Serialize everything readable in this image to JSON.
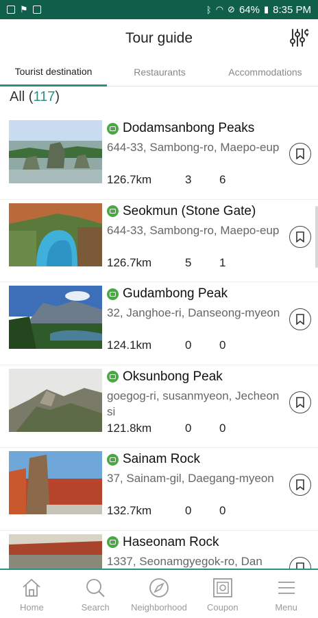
{
  "status_bar": {
    "battery": "64%",
    "time": "8:35 PM",
    "left_icons": [
      "image-icon",
      "flag-icon",
      "google-icon"
    ],
    "right_icons": [
      "bluetooth-icon",
      "wifi-icon",
      "do-not-disturb-icon",
      "battery-icon"
    ]
  },
  "header": {
    "title": "Tour guide",
    "filter_icon": "sliders-icon"
  },
  "tabs": [
    {
      "label": "Tourist destination",
      "active": true
    },
    {
      "label": "Restaurants",
      "active": false
    },
    {
      "label": "Accommodations",
      "active": false
    }
  ],
  "summary": {
    "label": "All",
    "open": "(",
    "count": "117",
    "close": ")"
  },
  "items": [
    {
      "name": "Dodamsanbong Peaks",
      "address": "644-33, Sambong-ro, Maepo-eup",
      "distance": "126.7km",
      "count_a": "3",
      "count_b": "6"
    },
    {
      "name": "Seokmun (Stone Gate)",
      "address": "644-33, Sambong-ro, Maepo-eup",
      "distance": "126.7km",
      "count_a": "5",
      "count_b": "1"
    },
    {
      "name": "Gudambong Peak",
      "address": "32, Janghoe-ri, Danseong-myeon",
      "distance": "124.1km",
      "count_a": "0",
      "count_b": "0"
    },
    {
      "name": "Oksunbong Peak",
      "address": "goegog-ri, susanmyeon, Jecheonsi",
      "distance": "121.8km",
      "count_a": "0",
      "count_b": "0"
    },
    {
      "name": "Sainam Rock",
      "address": "37, Sainam-gil, Daegang-myeon",
      "distance": "132.7km",
      "count_a": "0",
      "count_b": "0"
    },
    {
      "name": "Haseonam Rock",
      "address": "1337, Seonamgyegok-ro, Dan",
      "distance": "",
      "count_a": "",
      "count_b": ""
    }
  ],
  "bottom_nav": [
    {
      "label": "Home",
      "icon": "home-icon"
    },
    {
      "label": "Search",
      "icon": "search-icon"
    },
    {
      "label": "Neighborhood",
      "icon": "compass-icon"
    },
    {
      "label": "Coupon",
      "icon": "coupon-icon"
    },
    {
      "label": "Menu",
      "icon": "menu-icon"
    }
  ],
  "colors": {
    "status_bar": "#0f5f4a",
    "accent": "#2c8f86",
    "category_badge": "#4aa846"
  }
}
